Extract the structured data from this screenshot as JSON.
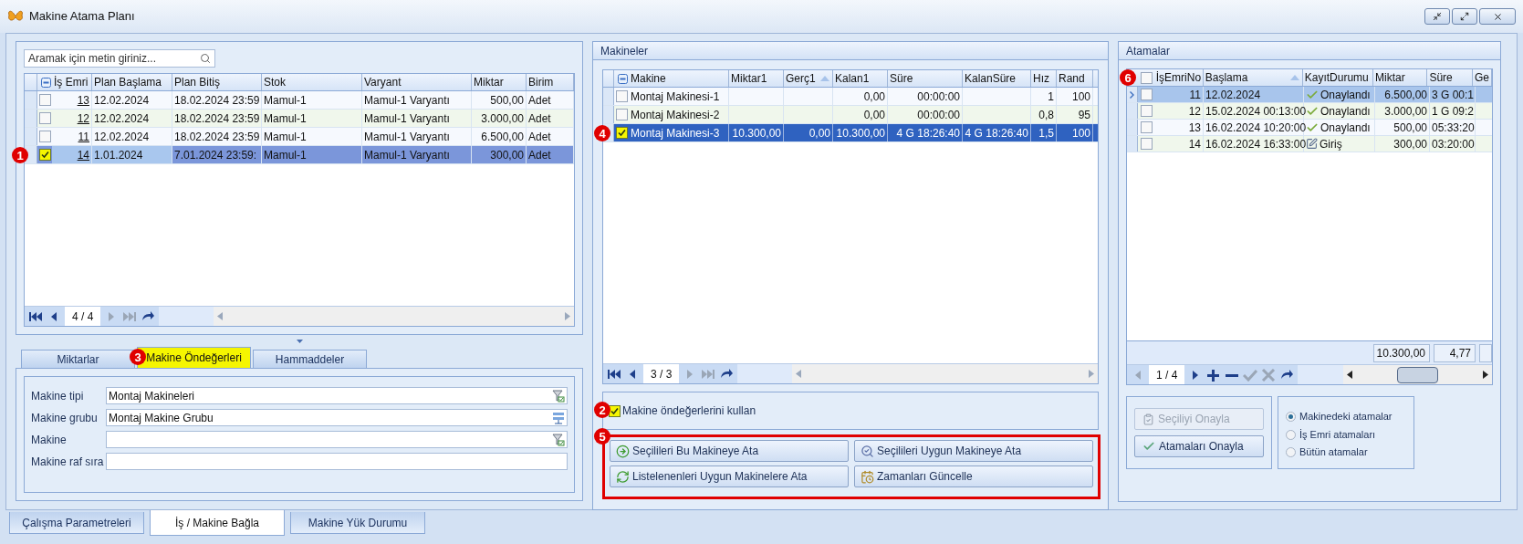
{
  "window": {
    "title": "Makine Atama Planı"
  },
  "orders": {
    "search": {
      "placeholder": "Aramak için metin giriniz..."
    },
    "columns": [
      {
        "label": "İş Emri",
        "sorted": false
      },
      {
        "label": "Plan Başlama",
        "sorted": false
      },
      {
        "label": "Plan Bitiş",
        "sorted": false
      },
      {
        "label": "Stok",
        "sorted": false
      },
      {
        "label": "Varyant",
        "sorted": false
      },
      {
        "label": "Miktar",
        "sorted": false
      },
      {
        "label": "Birim",
        "sorted": false
      }
    ],
    "rows": [
      {
        "checked": false,
        "selected": false,
        "highlighted": false,
        "cells": [
          "13",
          "12.02.2024",
          "18.02.2024 23:59",
          "Mamul-1",
          "Mamul-1 Varyantı",
          "500,00",
          "Adet"
        ]
      },
      {
        "checked": false,
        "selected": false,
        "highlighted": false,
        "cells": [
          "12",
          "12.02.2024",
          "18.02.2024 23:59",
          "Mamul-1",
          "Mamul-1 Varyantı",
          "3.000,00",
          "Adet"
        ]
      },
      {
        "checked": false,
        "selected": false,
        "highlighted": false,
        "cells": [
          "11",
          "12.02.2024",
          "18.02.2024 23:59",
          "Mamul-1",
          "Mamul-1 Varyantı",
          "6.500,00",
          "Adet"
        ]
      },
      {
        "checked": true,
        "selected": true,
        "highlighted": true,
        "callout": "1",
        "cells": [
          "14",
          "1.01.2024",
          "7.01.2024 23:59:",
          "Mamul-1",
          "Mamul-1 Varyantı",
          "300,00",
          "Adet"
        ]
      }
    ],
    "position": "4 / 4"
  },
  "detail_tabs": [
    {
      "label": "Miktarlar",
      "selected": false,
      "highlighted": false
    },
    {
      "label": "Makine Öndeğerleri",
      "selected": true,
      "highlighted": true,
      "callout": "3"
    },
    {
      "label": "Hammaddeler",
      "selected": false,
      "highlighted": false
    }
  ],
  "form": [
    {
      "label": "Makine tipi",
      "value": "Montaj Makineleri"
    },
    {
      "label": "Makine grubu",
      "value": "Montaj Makine Grubu"
    },
    {
      "label": "Makine"
    },
    {
      "label": "Makine raf sıra"
    }
  ],
  "machines": {
    "title": "Makineler",
    "columns": [
      {
        "label": "Makine",
        "sorted": false
      },
      {
        "label": "Miktar1",
        "sorted": false
      },
      {
        "label": "Gerç1",
        "sorted": true
      },
      {
        "label": "Kalan1",
        "sorted": false
      },
      {
        "label": "Süre",
        "sorted": false
      },
      {
        "label": "KalanSüre",
        "sorted": false
      },
      {
        "label": "Hız",
        "sorted": false
      },
      {
        "label": "Rand",
        "sorted": false
      }
    ],
    "rows": [
      {
        "checked": false,
        "selected": false,
        "highlighted": false,
        "cells": [
          "Montaj Makinesi-1",
          "",
          "",
          "0,00",
          "00:00:00",
          "",
          "1",
          "100"
        ]
      },
      {
        "checked": false,
        "selected": false,
        "highlighted": false,
        "cells": [
          "Montaj Makinesi-2",
          "",
          "",
          "0,00",
          "00:00:00",
          "",
          "0,8",
          "95"
        ]
      },
      {
        "checked": true,
        "selected": true,
        "highlighted": true,
        "callout": "4",
        "cells": [
          "Montaj Makinesi-3",
          "10.300,00",
          "0,00",
          "10.300,00",
          "4 G 18:26:40",
          "4 G 18:26:40",
          "1,5",
          "100"
        ]
      }
    ],
    "position": "3 / 3",
    "use_defaults": {
      "label": "Makine öndeğerlerini kullan",
      "checked": true,
      "highlighted": true,
      "callout": "2"
    },
    "actions": {
      "callout": "5",
      "buttons": [
        "Seçilileri Bu Makineye Ata",
        "Seçilileri Uygun Makineye Ata",
        "Listelenenleri Uygun Makinelere Ata",
        "Zamanları Güncelle"
      ]
    }
  },
  "assignments": {
    "title": "Atamalar",
    "callout": "6",
    "header_checked": false,
    "columns": [
      {
        "label": "İşEmriNo",
        "sorted": false
      },
      {
        "label": "Başlama",
        "sorted": true
      },
      {
        "label": "KayıtDurumu",
        "sorted": false
      },
      {
        "label": "Miktar",
        "sorted": false
      },
      {
        "label": "Süre",
        "sorted": false
      },
      {
        "label": "Ge",
        "sorted": false
      }
    ],
    "rows": [
      {
        "checked": false,
        "selected": true,
        "cells": [
          "11",
          "12.02.2024"
        ],
        "status": {
          "kind": "approved",
          "label": "Onaylandı"
        },
        "tail": [
          "6.500,00",
          "3 G 00:1"
        ]
      },
      {
        "checked": false,
        "selected": false,
        "cells": [
          "12",
          "15.02.2024 00:13:00"
        ],
        "status": {
          "kind": "approved",
          "label": "Onaylandı"
        },
        "tail": [
          "3.000,00",
          "1 G 09:2"
        ]
      },
      {
        "checked": false,
        "selected": false,
        "cells": [
          "13",
          "16.02.2024 10:20:00"
        ],
        "status": {
          "kind": "approved",
          "label": "Onaylandı"
        },
        "tail": [
          "500,00",
          "05:33:20"
        ]
      },
      {
        "checked": false,
        "selected": false,
        "cells": [
          "14",
          "16.02.2024 16:33:00"
        ],
        "status": {
          "kind": "entry",
          "label": "Giriş"
        },
        "tail": [
          "300,00",
          "03:20:00"
        ]
      }
    ],
    "totals": [
      "10.300,00",
      "4,77"
    ],
    "position": "1 / 4",
    "buttons": [
      {
        "label": "Seçiliyi Onayla",
        "disabled": true
      },
      {
        "label": "Atamaları Onayla",
        "disabled": false
      }
    ],
    "views": [
      {
        "label": "Makinedeki atamalar",
        "selected": true
      },
      {
        "label": "İş Emri atamaları",
        "selected": false
      },
      {
        "label": "Bütün atamalar",
        "selected": false
      }
    ]
  },
  "bottom_tabs": [
    {
      "label": "Çalışma Parametreleri",
      "selected": false
    },
    {
      "label": "İş / Makine Bağla",
      "selected": true
    },
    {
      "label": "Makine Yük Durumu",
      "selected": false
    }
  ]
}
